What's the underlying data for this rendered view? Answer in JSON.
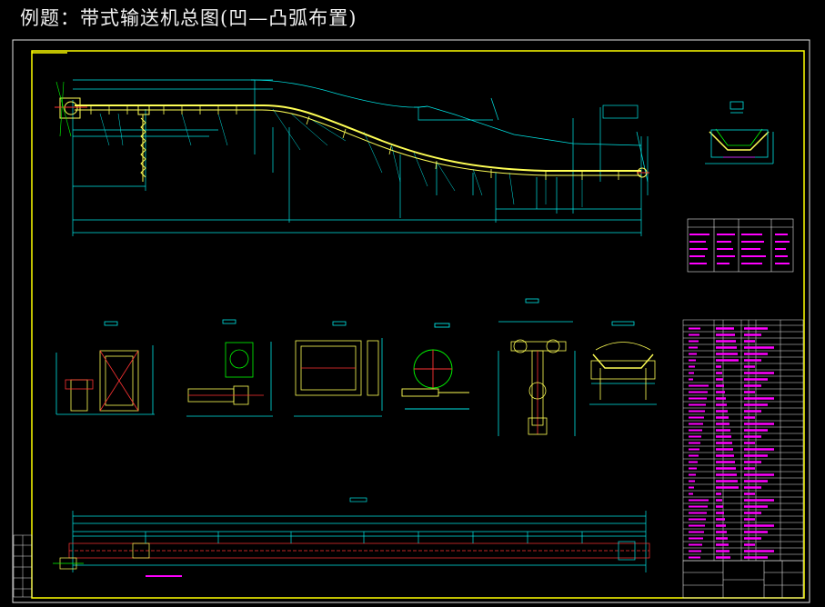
{
  "title": "例题：带式输送机总图(凹—凸弧布置)",
  "colors": {
    "background": "#000000",
    "frame": "#ffff00",
    "border": "#ffffff",
    "dimension": "#00ffff",
    "belt": "#ffff66",
    "table_text": "#ff00ff",
    "chain": "#ff3333",
    "detail": "#00ff00"
  },
  "views": [
    {
      "name": "belt-profile-elevation"
    },
    {
      "name": "head-section-detail"
    },
    {
      "name": "trough-idler-section"
    },
    {
      "name": "drive-unit-detail"
    },
    {
      "name": "chute-detail"
    },
    {
      "name": "pulley-detail"
    },
    {
      "name": "tensioner-detail"
    },
    {
      "name": "return-idler-detail"
    },
    {
      "name": "plan-view"
    }
  ],
  "tables": [
    {
      "name": "parameter-table"
    },
    {
      "name": "parts-list-table"
    },
    {
      "name": "title-block"
    }
  ]
}
